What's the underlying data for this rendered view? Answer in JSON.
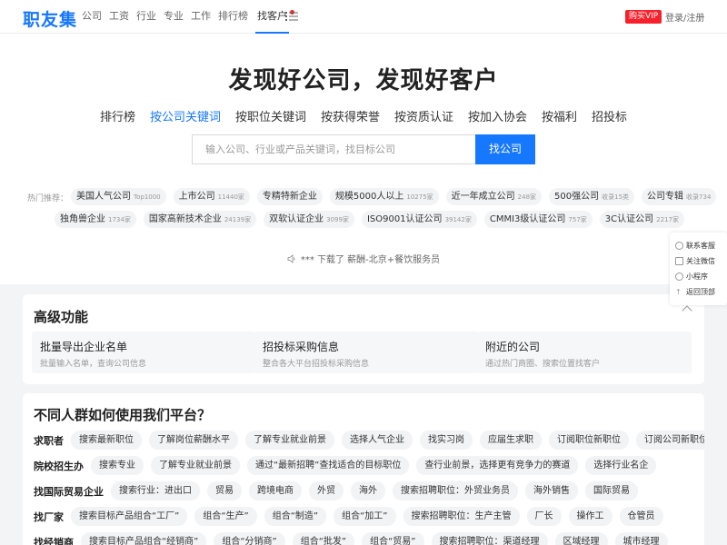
{
  "header": {
    "logo": "职友集",
    "nav": [
      "公司",
      "工资",
      "行业",
      "专业",
      "工作",
      "排行榜",
      "找客户"
    ],
    "vip": "购买VIP",
    "login": "登录/注册"
  },
  "hero": {
    "title": "发现好公司，发现好客户",
    "tabs": [
      "排行榜",
      "按公司关键词",
      "按职位关键词",
      "按获得荣誉",
      "按资质认证",
      "按加入协会",
      "按福利",
      "招投标"
    ],
    "active_tab": "按公司关键词",
    "search_placeholder": "输入公司、行业或产品关键词，找目标公司",
    "search_button": "找公司",
    "hot_label": "热门推荐：",
    "hot_row1": [
      {
        "name": "美国人气公司",
        "count": "Top1000"
      },
      {
        "name": "上市公司",
        "count": "11440家"
      },
      {
        "name": "专精特新企业",
        "count": ""
      },
      {
        "name": "规模5000人以上",
        "count": "10275家"
      },
      {
        "name": "近一年成立公司",
        "count": "248家"
      },
      {
        "name": "500强公司",
        "count": "收录15类"
      },
      {
        "name": "公司专辑",
        "count": "收录734"
      }
    ],
    "hot_row2": [
      {
        "name": "独角兽企业",
        "count": "1734家"
      },
      {
        "name": "国家高新技术企业",
        "count": "24139家"
      },
      {
        "name": "双软认证企业",
        "count": "3099家"
      },
      {
        "name": "ISO9001认证公司",
        "count": "39142家"
      },
      {
        "name": "CMMI3级认证公司",
        "count": "757家"
      },
      {
        "name": "3C认证公司",
        "count": "2217家"
      }
    ],
    "ticker": "*** 下载了 薪酬-北京+餐饮服务员"
  },
  "side": [
    "联系客服",
    "关注微信",
    "小程序",
    "返回顶部"
  ],
  "advanced": {
    "title": "高级功能",
    "features": [
      {
        "title": "批量导出企业名单",
        "desc": "批量输入名单，查询公司信息"
      },
      {
        "title": "招投标采购信息",
        "desc": "整合各大平台招投标采购信息"
      },
      {
        "title": "附近的公司",
        "desc": "通过热门商圈、搜索位置找客户"
      }
    ]
  },
  "usage": {
    "title": "不同人群如何使用我们平台？",
    "rows": [
      {
        "label": "求职者",
        "tags": [
          "搜索最新职位",
          "了解岗位薪酬水平",
          "了解专业就业前景",
          "选择人气企业",
          "找实习岗",
          "应届生求职",
          "订阅职位新职位",
          "订阅公司新职位"
        ]
      },
      {
        "label": "院校招生办",
        "tags": [
          "搜索专业",
          "了解专业就业前景",
          "通过“最新招聘”查找适合的目标职位",
          "查行业前景，选择更有竞争力的赛道",
          "选择行业名企"
        ]
      },
      {
        "label": "找国际贸易企业",
        "tags": [
          "搜索行业：进出口",
          "贸易",
          "跨境电商",
          "外贸",
          "海外",
          "搜索招聘职位：外贸业务员",
          "海外销售",
          "国际贸易"
        ]
      },
      {
        "label": "找厂家",
        "tags": [
          "搜索目标产品组合“工厂”",
          "组合“生产”",
          "组合“制造”",
          "组合“加工”",
          "搜索招聘职位：生产主管",
          "厂长",
          "操作工",
          "仓管员"
        ]
      },
      {
        "label": "找经销商",
        "tags": [
          "搜索目标产品组合“经销商”",
          "组合“分销商”",
          "组合“批发”",
          "组合“贸易”",
          "搜索招聘职位：渠道经理",
          "区域经理",
          "城市经理"
        ]
      }
    ]
  }
}
